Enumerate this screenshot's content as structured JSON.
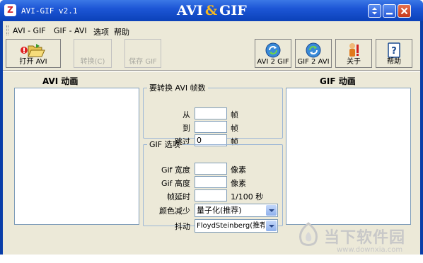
{
  "window": {
    "title": "AVI-GIF v2.1",
    "brand_left": "AVI",
    "brand_amp": "&",
    "brand_right": "GIF",
    "controls": [
      "restore-icon",
      "minimize-icon",
      "close-icon"
    ]
  },
  "menu": [
    {
      "label": "AVI - GIF"
    },
    {
      "label": "GIF - AVI"
    },
    {
      "label": "选项"
    },
    {
      "label": "帮助"
    }
  ],
  "toolbar": {
    "open": "打开 AVI",
    "convert": "转换(C)",
    "save_gif": "保存 GIF",
    "avi2gif": "AVI 2 GIF",
    "gif2avi": "GIF 2 AVI",
    "about": "关于",
    "help": "帮助"
  },
  "left_panel": {
    "title": "AVI  动画"
  },
  "right_panel": {
    "title": "GIF  动画"
  },
  "frames": {
    "legend": "要转换 AVI 帧数",
    "from_label": "从",
    "from_value": "",
    "to_label": "到",
    "to_value": "",
    "skip_label": "跳过",
    "skip_value": "0",
    "unit": "帧"
  },
  "gif_options": {
    "legend": "GIF 选项",
    "width_label": "Gif 宽度",
    "width_value": "",
    "height_label": "Gif 高度",
    "height_value": "",
    "pixel_unit": "像素",
    "delay_label": "帧延时",
    "delay_value": "",
    "delay_unit": "1/100 秒",
    "color_label": "颜色减少",
    "color_value": "量子化(推荐)",
    "dither_label": "抖动",
    "dither_value": "FloydSteinberg(推荐)"
  },
  "watermark": {
    "text_cn": "当下软件园",
    "text_url": "www.downxia.com"
  },
  "colors": {
    "titlebar": "#0b41b8",
    "face": "#ece9d8",
    "accent": "#f5b820",
    "field_border": "#7f9db9"
  }
}
